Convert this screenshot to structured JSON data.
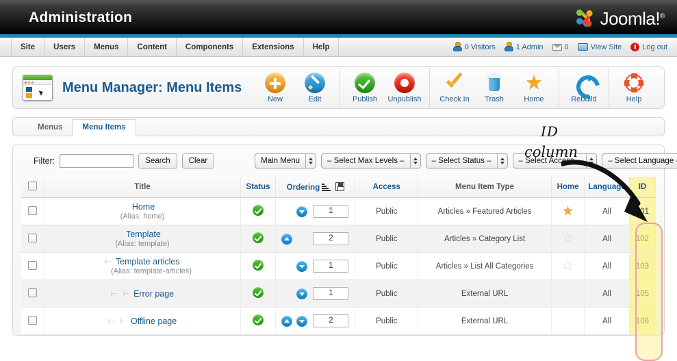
{
  "header": {
    "title": "Administration",
    "brand": "Joomla!",
    "brand_sup": "®"
  },
  "menubar": {
    "items": [
      {
        "label": "Site",
        "name": "site"
      },
      {
        "label": "Users",
        "name": "users"
      },
      {
        "label": "Menus",
        "name": "menus"
      },
      {
        "label": "Content",
        "name": "content"
      },
      {
        "label": "Components",
        "name": "components"
      },
      {
        "label": "Extensions",
        "name": "extensions"
      },
      {
        "label": "Help",
        "name": "help"
      }
    ],
    "status": {
      "visitors": "0 Visitors",
      "admins": "1 Admin",
      "messages": "0",
      "view_site": "View Site",
      "log_out": "Log out"
    }
  },
  "page": {
    "title": "Menu Manager: Menu Items",
    "icon": "menu-manager-icon"
  },
  "toolbar": {
    "groups": [
      [
        {
          "label": "New",
          "icon": "plus-icon"
        },
        {
          "label": "Edit",
          "icon": "pencil-icon"
        }
      ],
      [
        {
          "label": "Publish",
          "icon": "check-circle-icon"
        },
        {
          "label": "Unpublish",
          "icon": "dot-circle-icon"
        }
      ],
      [
        {
          "label": "Check In",
          "icon": "checkmark-icon"
        },
        {
          "label": "Trash",
          "icon": "trash-icon"
        },
        {
          "label": "Home",
          "icon": "star-icon"
        }
      ],
      [
        {
          "label": "Rebuild",
          "icon": "refresh-icon"
        }
      ],
      [
        {
          "label": "Help",
          "icon": "lifering-icon"
        }
      ]
    ]
  },
  "tabs": [
    {
      "label": "Menus",
      "active": false
    },
    {
      "label": "Menu Items",
      "active": true
    }
  ],
  "filter": {
    "label": "Filter:",
    "value": "",
    "placeholder": "",
    "search_label": "Search",
    "clear_label": "Clear",
    "selects": [
      {
        "name": "menu-select",
        "value": "Main Menu"
      },
      {
        "name": "max-levels-select",
        "value": "– Select Max Levels –"
      },
      {
        "name": "status-select",
        "value": "– Select Status –"
      },
      {
        "name": "access-select",
        "value": "– Select Access –"
      },
      {
        "name": "language-select",
        "value": "– Select Language –"
      }
    ]
  },
  "table": {
    "headers": {
      "checkbox": "",
      "title": "Title",
      "status": "Status",
      "ordering": "Ordering",
      "access": "Access",
      "type": "Menu Item Type",
      "home": "Home",
      "language": "Language",
      "id": "ID"
    },
    "rows": [
      {
        "title": "Home",
        "alias": "(Alias: home)",
        "indent": "",
        "status": "published",
        "ord_up": false,
        "ord_down": true,
        "ordering": "1",
        "access": "Public",
        "type": "Articles » Featured Articles",
        "home": "filled",
        "language": "All",
        "id": "101"
      },
      {
        "title": "Template",
        "alias": "(Alias: template)",
        "indent": "",
        "status": "published",
        "ord_up": true,
        "ord_down": false,
        "ordering": "2",
        "access": "Public",
        "type": "Articles » Category List",
        "home": "empty",
        "language": "All",
        "id": "102"
      },
      {
        "title": "Template articles",
        "alias": "(Alias: template-articles)",
        "indent": "⊢",
        "status": "published",
        "ord_up": false,
        "ord_down": true,
        "ordering": "1",
        "access": "Public",
        "type": "Articles » List All Categories",
        "home": "empty",
        "language": "All",
        "id": "103"
      },
      {
        "title": "Error page",
        "alias": "",
        "indent": "⊢ ⊢",
        "status": "published",
        "ord_up": false,
        "ord_down": true,
        "ordering": "1",
        "access": "Public",
        "type": "External URL",
        "home": "none",
        "language": "All",
        "id": "105"
      },
      {
        "title": "Offline page",
        "alias": "",
        "indent": "⊢ ⊢",
        "status": "published",
        "ord_up": true,
        "ord_down": true,
        "ordering": "2",
        "access": "Public",
        "type": "External URL",
        "home": "none",
        "language": "All",
        "id": "106"
      }
    ]
  },
  "annotation": {
    "line1": "ID",
    "line2": "column",
    "arrow": "curved-arrow-pointing-to-id-column"
  },
  "colors": {
    "accent_blue": "#1b89b8",
    "link_blue": "#1c5a8d",
    "publish_green": "#19930c",
    "star_orange": "#f5a623",
    "id_highlight": "#fbf3a8",
    "id_border": "#f0a0a8"
  }
}
